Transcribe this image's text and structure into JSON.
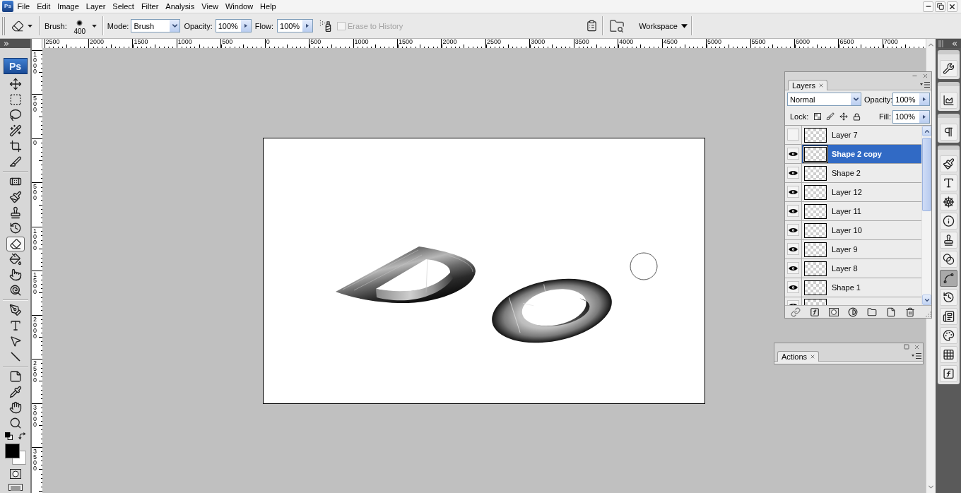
{
  "menu_bar": {
    "app_icon": "Ps",
    "items": [
      "File",
      "Edit",
      "Image",
      "Layer",
      "Select",
      "Filter",
      "Analysis",
      "View",
      "Window",
      "Help"
    ]
  },
  "options_bar": {
    "brush_label": "Brush:",
    "brush_size": "400",
    "mode_label": "Mode:",
    "mode": "Brush",
    "opacity_label": "Opacity:",
    "opacity": "100%",
    "flow_label": "Flow:",
    "flow": "100%",
    "erase_to_history": {
      "label": "Erase to History",
      "checked": false,
      "disabled": true
    },
    "workspace": "Workspace"
  },
  "toolbox": {
    "logo": "Ps",
    "tool_groups": [
      {
        "tools": [
          {
            "kind": "move",
            "selected": false
          },
          {
            "kind": "marquee",
            "selected": false
          },
          {
            "kind": "lasso",
            "selected": false
          },
          {
            "kind": "magic_wand",
            "selected": false
          },
          {
            "kind": "crop",
            "selected": false
          },
          {
            "kind": "slice",
            "selected": false
          }
        ]
      },
      {
        "tools": [
          {
            "kind": "healing",
            "selected": false
          },
          {
            "kind": "brush",
            "selected": false
          },
          {
            "kind": "clone_stamp",
            "selected": false
          },
          {
            "kind": "history_brush",
            "selected": false
          },
          {
            "kind": "eraser",
            "selected": true
          },
          {
            "kind": "paint_bucket",
            "selected": false
          },
          {
            "kind": "smudge",
            "selected": false
          },
          {
            "kind": "dodge",
            "selected": false
          }
        ]
      },
      {
        "tools": [
          {
            "kind": "pen",
            "selected": false
          },
          {
            "kind": "type",
            "selected": false
          },
          {
            "kind": "path_selection",
            "selected": false
          },
          {
            "kind": "line",
            "selected": false
          }
        ]
      },
      {
        "tools": [
          {
            "kind": "notes",
            "selected": false
          },
          {
            "kind": "eyedropper",
            "selected": false
          },
          {
            "kind": "hand",
            "selected": false
          },
          {
            "kind": "zoom",
            "selected": false
          }
        ]
      }
    ]
  },
  "rulers": {
    "horizontal": [
      "2500",
      "2000",
      "1500",
      "1000",
      "500",
      "0",
      "500",
      "1000",
      "1500",
      "2000",
      "2500",
      "3000",
      "3500",
      "4000",
      "4500",
      "5000",
      "5500",
      "6000",
      "6500",
      "7000"
    ],
    "vertical": [
      "1000",
      "500",
      "0",
      "500",
      "1000",
      "1500",
      "2000",
      "2500",
      "3000",
      "3500"
    ]
  },
  "layers_panel": {
    "tab": "Layers",
    "blend_mode": "Normal",
    "opacity_label": "Opacity:",
    "opacity": "100%",
    "lock_label": "Lock:",
    "fill_label": "Fill:",
    "fill": "100%",
    "layers": [
      {
        "name": "Layer 7",
        "visible": false,
        "selected": false
      },
      {
        "name": "Shape 2 copy",
        "visible": true,
        "selected": true
      },
      {
        "name": "Shape 2",
        "visible": true,
        "selected": false
      },
      {
        "name": "Layer 12",
        "visible": true,
        "selected": false
      },
      {
        "name": "Layer 11",
        "visible": true,
        "selected": false
      },
      {
        "name": "Layer 10",
        "visible": true,
        "selected": false
      },
      {
        "name": "Layer 9",
        "visible": true,
        "selected": false
      },
      {
        "name": "Layer 8",
        "visible": true,
        "selected": false
      },
      {
        "name": "Shape 1",
        "visible": true,
        "selected": false
      },
      {
        "visible": true,
        "selected": false
      }
    ]
  },
  "actions_panel": {
    "tab": "Actions"
  },
  "dock": {
    "groups": [
      {
        "panels": [
          {
            "kind": "tool_presets",
            "selected": false
          }
        ]
      },
      {
        "panels": [
          {
            "kind": "histogram",
            "selected": false
          }
        ]
      },
      {
        "panels": [
          {
            "kind": "paragraph",
            "selected": false
          }
        ]
      },
      {
        "panels": [
          {
            "kind": "brushes",
            "selected": false
          },
          {
            "kind": "character",
            "selected": false
          },
          {
            "kind": "navigator",
            "selected": false
          },
          {
            "kind": "info",
            "selected": false
          },
          {
            "kind": "clone_source",
            "selected": false
          },
          {
            "kind": "channels",
            "selected": false
          },
          {
            "kind": "paths",
            "selected": true
          },
          {
            "kind": "history",
            "selected": false
          },
          {
            "kind": "layer_comps",
            "selected": false
          },
          {
            "kind": "color",
            "selected": false
          },
          {
            "kind": "swatches",
            "selected": false
          },
          {
            "kind": "styles",
            "selected": false
          }
        ]
      }
    ]
  }
}
